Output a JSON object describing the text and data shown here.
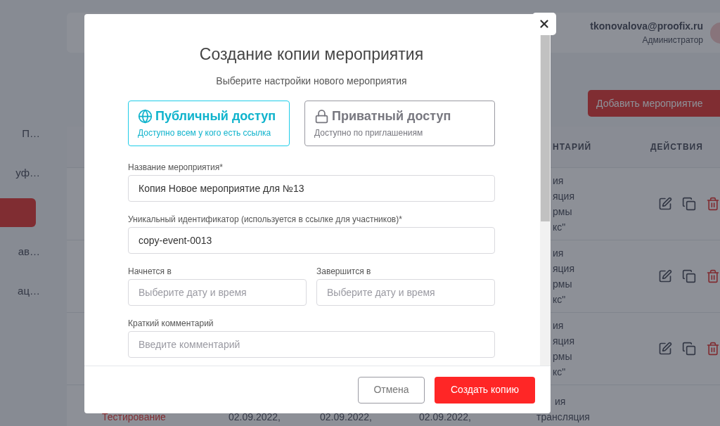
{
  "background": {
    "sidebar": {
      "items": [
        {
          "label": "П…",
          "selected": false
        },
        {
          "label": "уф…",
          "selected": false
        },
        {
          "selected": true
        },
        {
          "label": "ав…",
          "selected": false
        },
        {
          "label": "ац…",
          "selected": false
        }
      ]
    },
    "header": {
      "email": "tkonovalova@proofix.ru",
      "role": "Администратор"
    },
    "add_button": "Добавить мероприятие",
    "table": {
      "columns": [
        "НТАРИЙ",
        "ДЕЙСТВИЯ"
      ],
      "rows": [
        {
          "comment": [
            "ия",
            "яция",
            "рмы",
            "кс\""
          ]
        },
        {
          "comment": [
            "ия",
            "яция",
            "рмы",
            "кс\""
          ]
        },
        {
          "comment": [
            "ия",
            "яция",
            "рмы",
            "кс\""
          ]
        }
      ],
      "last_row": {
        "name": "Тестирование",
        "dates": [
          "02.09.2022,",
          "02.09.2022,",
          "02.09.2022,"
        ],
        "comment": [
          "ия",
          "трансляция"
        ]
      }
    }
  },
  "dialog": {
    "title": "Создание копии мероприятия",
    "subtitle": "Выберите настройки нового мероприятия",
    "access_options": [
      {
        "kind": "public",
        "title": "Публичный доступ",
        "description": "Доступно всем у кого есть ссылка",
        "selected": true
      },
      {
        "kind": "private",
        "title": "Приватный доступ",
        "description": "Доступно по приглашениям",
        "selected": false
      }
    ],
    "name_field": {
      "label": "Название мероприятия*",
      "value": "Копия Новое мероприятие для №13"
    },
    "id_field": {
      "label": "Уникальный идентификатор (используется в ссылке для участников)*",
      "value": "copy-event-0013"
    },
    "start_field": {
      "label": "Начнется в",
      "placeholder": "Выберите дату и время"
    },
    "end_field": {
      "label": "Завершится в",
      "placeholder": "Выберите дату и время"
    },
    "comment_field": {
      "label": "Краткий комментарий",
      "placeholder": "Введите комментарий"
    },
    "buttons": {
      "cancel": "Отмена",
      "submit": "Создать копию"
    }
  }
}
